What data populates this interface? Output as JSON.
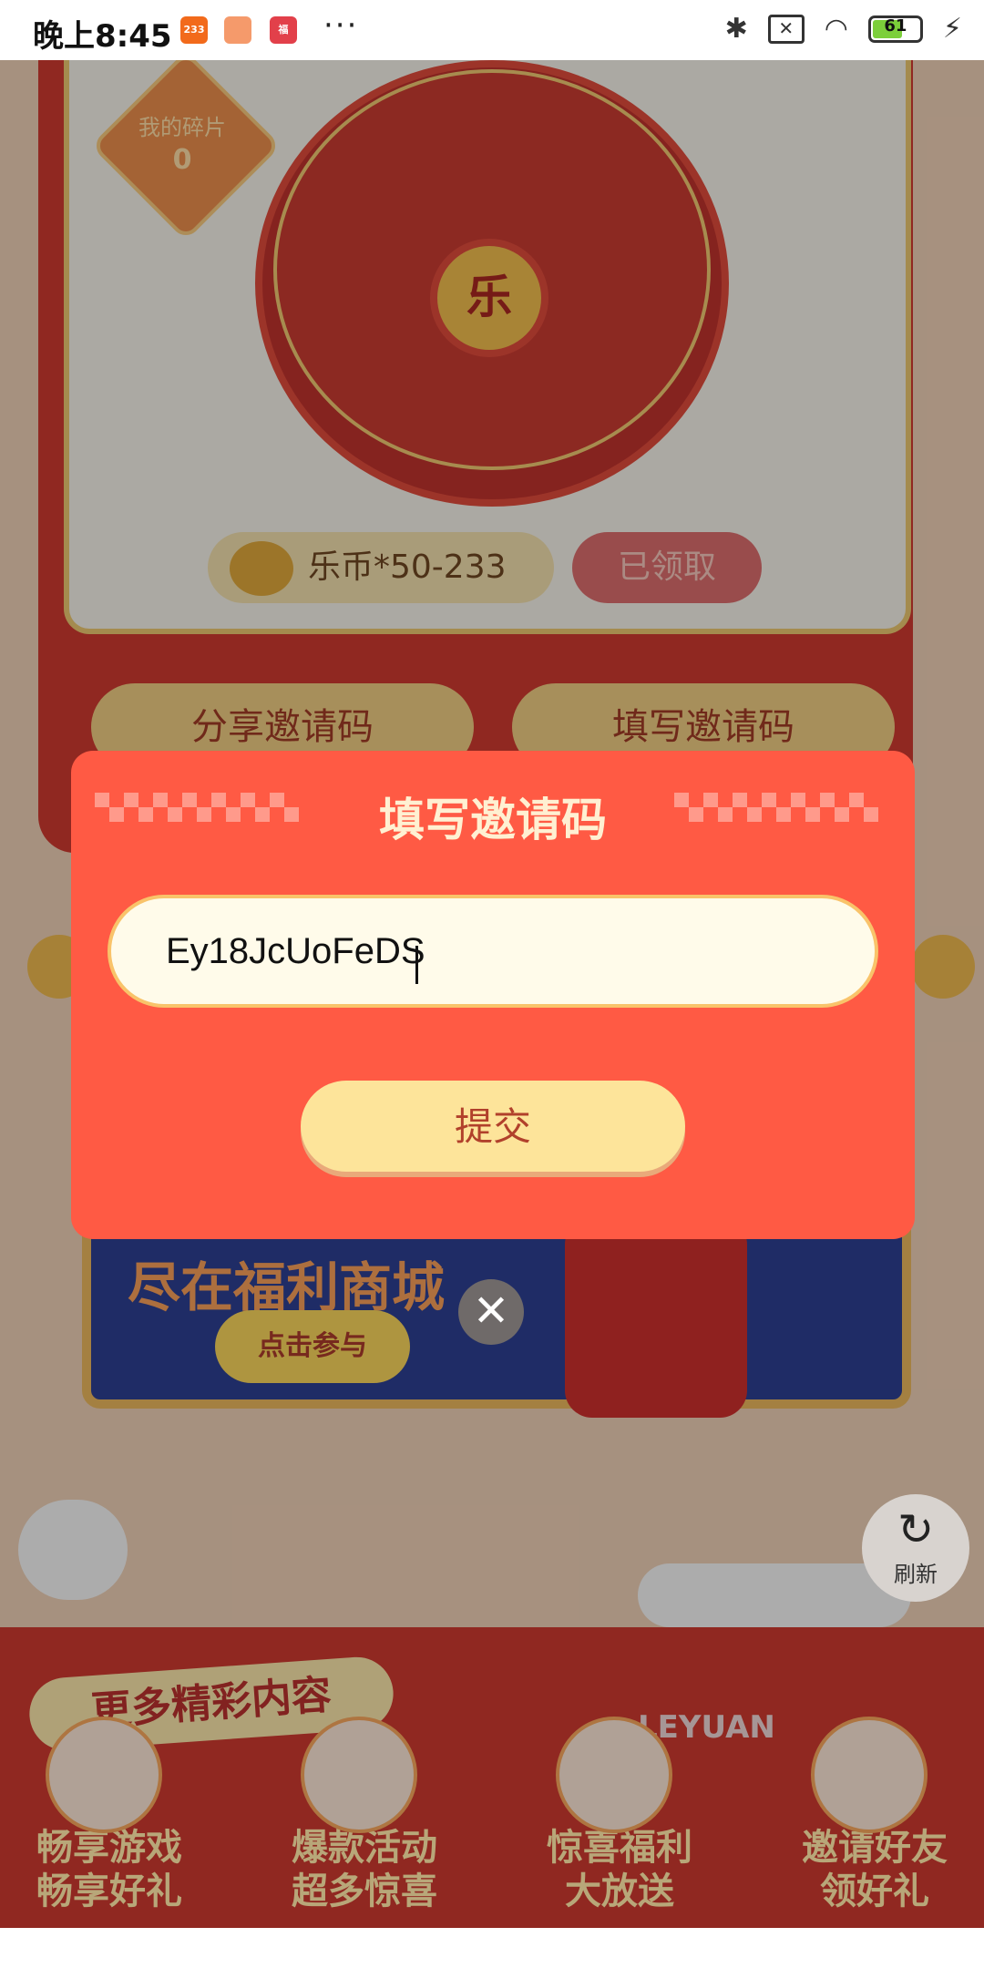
{
  "status_bar": {
    "time": "晚上8:45",
    "app_badge_233": "233",
    "app_badge_red": "福",
    "more_dots": "···",
    "battery_level": "61"
  },
  "background": {
    "fragments_label": "我的碎片",
    "fragments_count": "0",
    "wheel_center": "乐",
    "reward_text": "乐币*50-233",
    "claimed_label": "已领取",
    "share_code_label": "分享邀请码",
    "fill_code_label": "填写邀请码",
    "banner_title": "尽在福利商城",
    "banner_button": "点击参与",
    "refresh_label": "刷新",
    "more_content_tag": "更多精彩内容",
    "brand_text": "LEYUAN",
    "features": [
      {
        "line1": "畅享游戏",
        "line2": "畅享好礼"
      },
      {
        "line1": "爆款活动",
        "line2": "超多惊喜"
      },
      {
        "line1": "惊喜福利",
        "line2": "大放送"
      },
      {
        "line1": "邀请好友",
        "line2": "领好礼"
      }
    ]
  },
  "modal": {
    "title": "填写邀请码",
    "input_value": "Ey18JcUoFeDS",
    "submit_label": "提交",
    "close_icon": "close-icon"
  }
}
